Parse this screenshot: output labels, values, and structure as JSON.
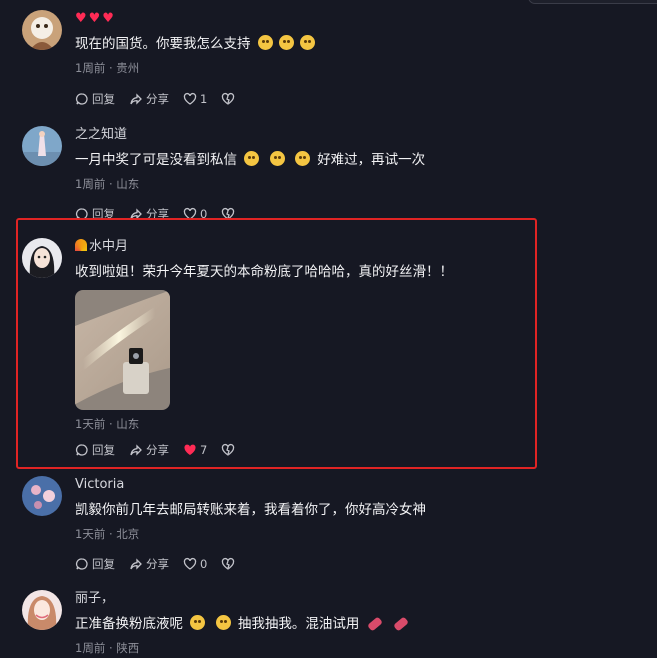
{
  "comments": [
    {
      "name": "",
      "name_hearts": "♥♥♥",
      "text": "现在的国货。你要我怎么支持",
      "meta": "1周前 · 贵州",
      "reply": "回复",
      "share": "分享",
      "likes": "1",
      "liked": false
    },
    {
      "name": "之之知道",
      "text_a": "一月中奖了可是没看到私信",
      "text_b": "好难过，再试一次",
      "meta": "1周前 · 山东",
      "reply": "回复",
      "share": "分享",
      "likes": "0",
      "liked": false
    },
    {
      "name": "水中月",
      "text": "收到啦姐！荣升今年夏天的本命粉底了哈哈哈，真的好丝滑！！",
      "meta": "1天前 · 山东",
      "reply": "回复",
      "share": "分享",
      "likes": "7",
      "liked": true
    },
    {
      "name": "Victoria",
      "text": "凯毅你前几年去邮局转账来着，我看着你了，你好高冷女神",
      "meta": "1天前 · 北京",
      "reply": "回复",
      "share": "分享",
      "likes": "0",
      "liked": false
    },
    {
      "name": "丽子，",
      "text_a": "正准备换粉底液呢",
      "text_b": "抽我抽我。混油试用",
      "meta": "1周前 · 陕西"
    }
  ],
  "colors": {
    "background": "#161823",
    "like_active": "#ff2b55",
    "highlight_border": "#e02424"
  }
}
